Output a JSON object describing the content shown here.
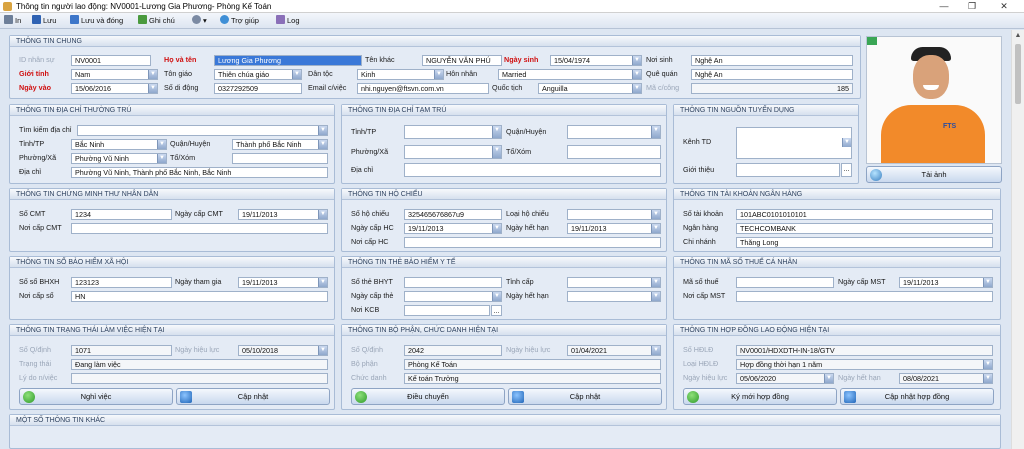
{
  "window": {
    "title": "Thông tin người lao động: NV0001-Lương Gia Phương- Phòng  Kế Toán",
    "minimize": "—",
    "restore": "❐",
    "close": "✕"
  },
  "toolbar": {
    "in": "In",
    "luu": "Lưu",
    "luu_dong": "Lưu và đóng",
    "ghi_chu": "Ghi chú",
    "tro_giup": "Trợ giúp",
    "log": "Log",
    "more": "▾"
  },
  "colors": {
    "accent": "#3a78d8",
    "red_label": "#d01010",
    "panel_header": "#2f4360"
  },
  "general": {
    "header": "THÔNG TIN CHUNG",
    "id_label": "ID nhân sự",
    "id_value": "NV0001",
    "name_label": "Họ và tên",
    "name_value": "Lương Gia Phương",
    "other_name_label": "Tên khác",
    "other_name_value": "NGUYỄN VĂN PHÚ",
    "dob_label": "Ngày sinh",
    "dob_value": "15/04/1974",
    "birthplace_label": "Nơi sinh",
    "birthplace_value": "Nghệ An",
    "gender_label": "Giới tính",
    "gender_value": "Nam",
    "religion_label": "Tôn giáo",
    "religion_value": "Thiên chúa giáo",
    "ethnic_label": "Dân tộc",
    "ethnic_value": "Kinh",
    "marital_label": "Hôn nhân",
    "marital_value": "Married",
    "hometown_label": "Quê quán",
    "hometown_value": "Nghệ An",
    "joindate_label": "Ngày vào",
    "joindate_value": "15/06/2016",
    "mobile_label": "Số di động",
    "mobile_value": "0327292509",
    "email_label": "Email c/việc",
    "email_value": "nhi.nguyen@ftsvn.com.vn",
    "nationality_label": "Quốc tịch",
    "nationality_value": "Anguilla",
    "attendance_label": "Mã c/công",
    "attendance_value": "185"
  },
  "permanent": {
    "header": "THÔNG TIN ĐỊA CHỈ THƯỜNG TRÚ",
    "search_label": "Tìm kiếm địa chỉ",
    "province_label": "Tỉnh/TP",
    "province_value": "Bắc Ninh",
    "district_label": "Quận/Huyện",
    "district_value": "Thành phố Bắc Ninh",
    "ward_label": "Phường/Xã",
    "ward_value": "Phường Vũ Ninh",
    "hamlet_label": "Tổ/Xóm",
    "address_label": "Địa chỉ",
    "address_value": "Phường Vũ Ninh, Thành phố Bắc Ninh, Bắc Ninh"
  },
  "temporary": {
    "header": "THÔNG TIN ĐỊA CHỈ TẠM TRÚ",
    "province_label": "Tỉnh/TP",
    "district_label": "Quận/Huyện",
    "ward_label": "Phường/Xã",
    "hamlet_label": "Tổ/Xóm",
    "address_label": "Địa chỉ"
  },
  "recruit": {
    "header": "THÔNG TIN NGUỒN TUYỂN DỤNG",
    "channel_label": "Kênh TD",
    "referrer_label": "Giới thiệu",
    "browse": "..."
  },
  "photo": {
    "upload_label": "Tải ảnh",
    "shirt_text": "FTS"
  },
  "idcard": {
    "header": "THÔNG TIN CHỨNG MINH THƯ NHÂN DÂN",
    "number_label": "Số CMT",
    "number_value": "1234",
    "date_label": "Ngày cấp CMT",
    "date_value": "19/11/2013",
    "place_label": "Nơi cấp CMT"
  },
  "passport": {
    "header": "THÔNG TIN HỘ CHIẾU",
    "number_label": "Số hộ chiếu",
    "number_value": "325465676867u9",
    "type_label": "Loại hộ chiếu",
    "date_label": "Ngày cấp HC",
    "date_value": "19/11/2013",
    "expire_label": "Ngày hết hạn",
    "expire_value": "19/11/2013",
    "place_label": "Nơi cấp HC"
  },
  "bank": {
    "header": "THÔNG TIN TÀI KHOẢN NGÂN HÀNG",
    "account_label": "Số tài khoản",
    "account_value": "101ABC0101010101",
    "bank_label": "Ngân hàng",
    "bank_value": "TECHCOMBANK",
    "branch_label": "Chi nhánh",
    "branch_value": "Thăng Long"
  },
  "social": {
    "header": "THÔNG TIN SỔ BẢO HIỂM XÃ HỘI",
    "number_label": "Số sổ BHXH",
    "number_value": "123123",
    "date_label": "Ngày tham gia",
    "date_value": "19/11/2013",
    "place_label": "Nơi cấp sổ",
    "place_value": "HN"
  },
  "health": {
    "header": "THÔNG TIN THẺ BẢO HIỂM Y TẾ",
    "number_label": "Số thẻ BHYT",
    "province_label": "Tỉnh cấp",
    "date_label": "Ngày cấp thẻ",
    "expire_label": "Ngày hết hạn",
    "clinic_label": "Nơi KCB",
    "browse": "..."
  },
  "tax": {
    "header": "THÔNG TIN MÃ SỐ THUẾ CÁ NHÂN",
    "code_label": "Mã số thuế",
    "date_label": "Ngày cấp MST",
    "date_value": "19/11/2013",
    "place_label": "Nơi cấp MST"
  },
  "workstatus": {
    "header": "THÔNG TIN TRẠNG THÁI LÀM VIỆC HIỆN TẠI",
    "decision_label": "Số Q/định",
    "decision_value": "1071",
    "effective_label": "Ngày hiệu lực",
    "effective_value": "05/10/2018",
    "status_label": "Trạng thái",
    "status_value": "Đang làm việc",
    "reason_label": "Lý do n/việc",
    "quit_button": "Nghỉ việc",
    "update_button": "Cập nhật"
  },
  "department": {
    "header": "THÔNG TIN BỘ PHẬN, CHỨC DANH HIỆN TẠI",
    "decision_label": "Số Q/định",
    "decision_value": "2042",
    "effective_label": "Ngày hiệu lực",
    "effective_value": "01/04/2021",
    "dept_label": "Bộ phận",
    "dept_value": "Phòng  Kế Toán",
    "title_label": "Chức danh",
    "title_value": "Kế toán Trưởng",
    "transfer_button": "Điều chuyển",
    "update_button": "Cập nhật"
  },
  "contract": {
    "header": "THÔNG TIN HỢP ĐỒNG LAO ĐỘNG HIỆN TẠI",
    "number_label": "Số HĐLĐ",
    "number_value": "NV0001/HDXDTH-IN-18/GTV",
    "type_label": "Loại HĐLĐ",
    "type_value": "Hợp đồng thời hạn 1 năm",
    "effective_label": "Ngày hiệu lực",
    "effective_value": "05/06/2020",
    "expire_label": "Ngày hết hạn",
    "expire_value": "08/08/2021",
    "sign_button": "Ký mới hợp đồng",
    "update_button": "Cập nhật hợp đồng"
  },
  "other": {
    "header": "MỘT SỐ THÔNG TIN KHÁC"
  }
}
